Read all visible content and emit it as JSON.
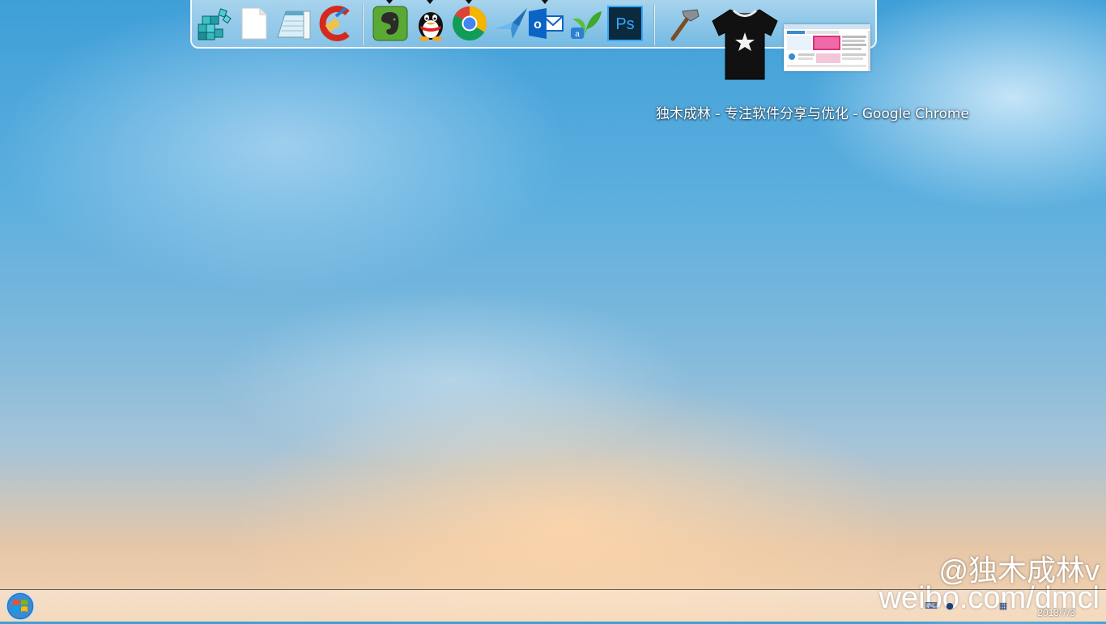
{
  "dock": {
    "items": [
      {
        "name": "registry-editor",
        "running": false
      },
      {
        "name": "blank-document",
        "running": false
      },
      {
        "name": "notepad",
        "running": false
      },
      {
        "name": "ccleaner",
        "running": false
      },
      {
        "name": "evernote",
        "running": true
      },
      {
        "name": "qq",
        "running": true
      },
      {
        "name": "google-chrome",
        "running": true
      },
      {
        "name": "xunlei-bird",
        "running": false
      },
      {
        "name": "outlook",
        "running": true
      },
      {
        "name": "app-sprout",
        "running": false
      },
      {
        "name": "photoshop",
        "running": false
      },
      {
        "name": "hammer-tool",
        "running": false
      }
    ],
    "photoshop_label": "Ps",
    "outlook_letter": "o"
  },
  "preview": {
    "tooltip": "独木成林 - 专注软件分享与优化 - Google Chrome"
  },
  "watermark": {
    "line1": "@独木成林v",
    "line2": "weibo.com/dmcl"
  },
  "taskbar": {
    "date": "2013/7/3"
  },
  "colors": {
    "sky_top": "#3f9fd8",
    "horizon_glow": "#f3d3b1",
    "evernote_green": "#5aa935",
    "chrome_red": "#db4437",
    "chrome_yellow": "#f4b400",
    "chrome_green": "#0f9d58",
    "outlook_blue": "#0a64c5",
    "photoshop_bg": "#0c2a3e",
    "photoshop_text": "#31a8ff"
  }
}
